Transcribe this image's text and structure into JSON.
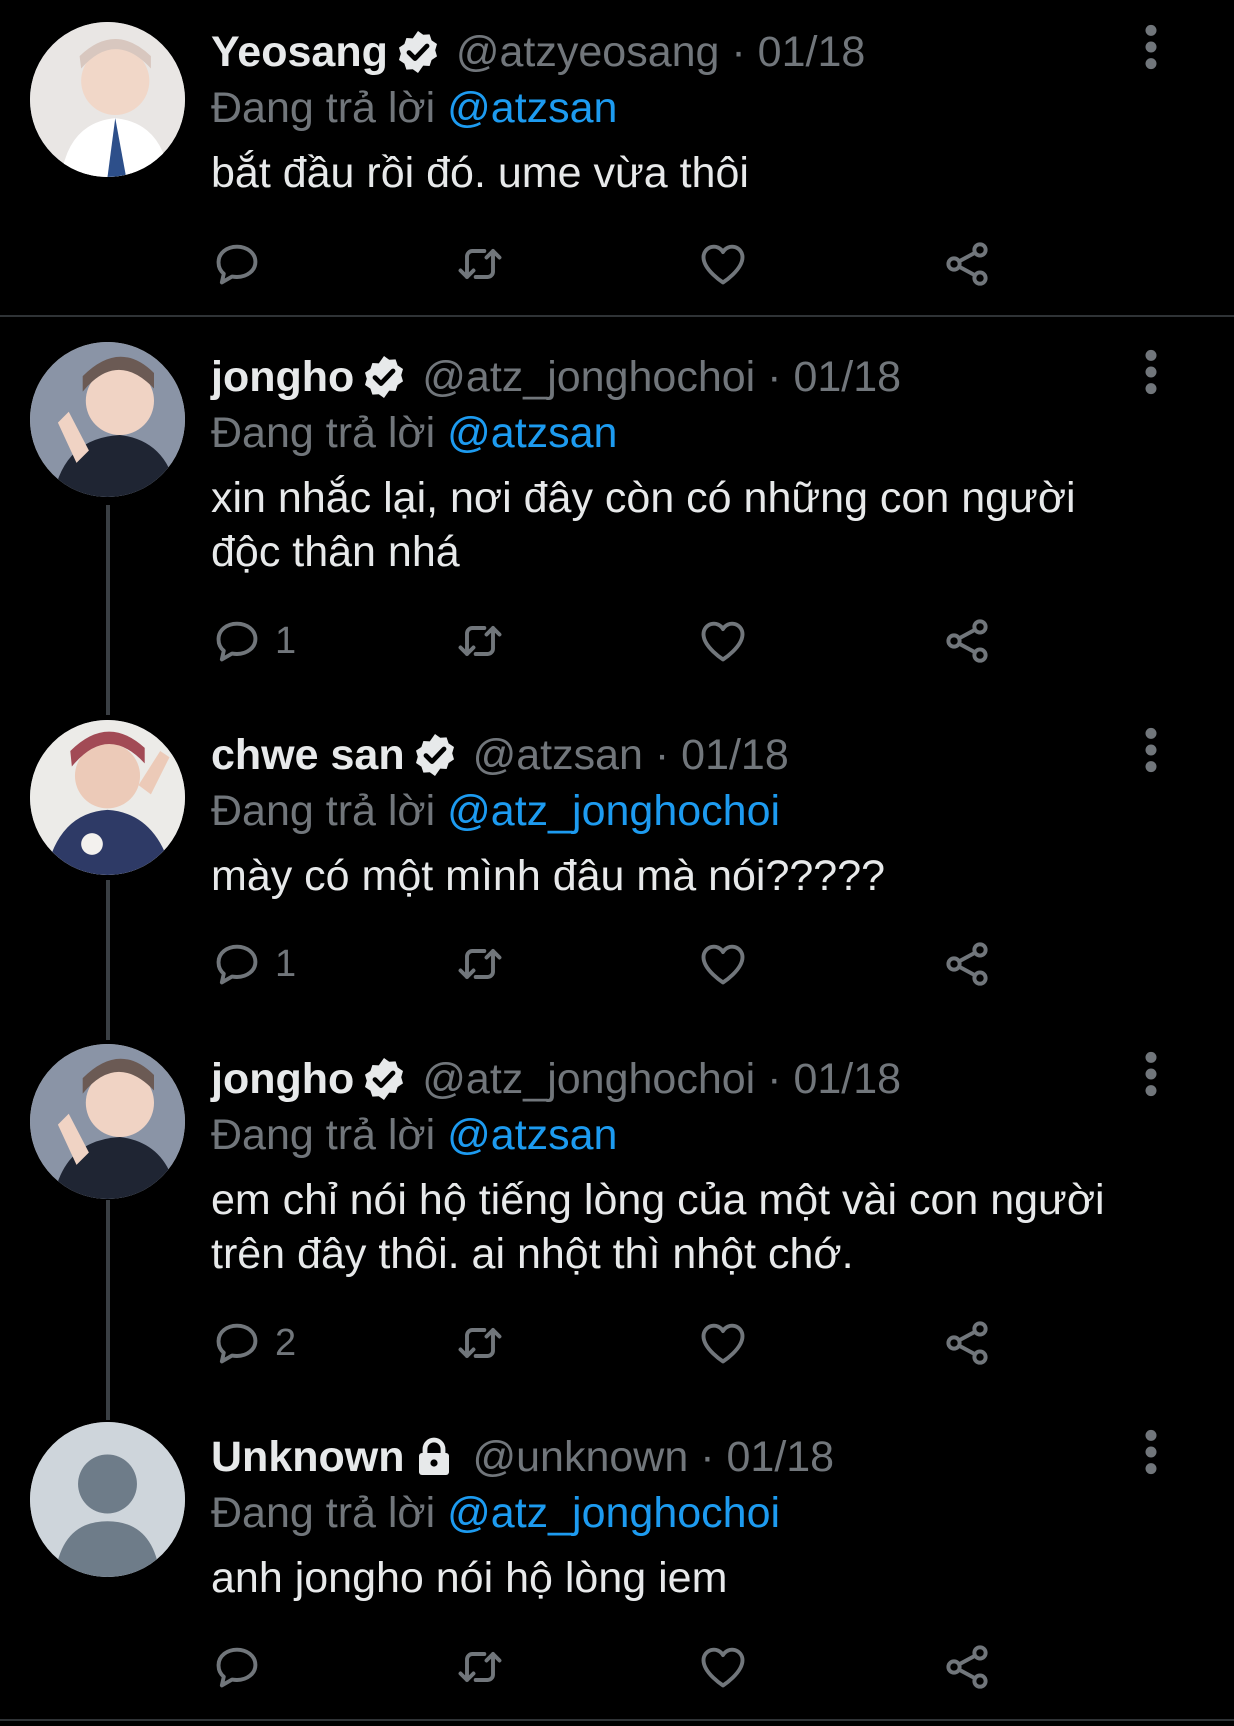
{
  "tweets": [
    {
      "name": "Yeosang",
      "verified": true,
      "locked": false,
      "handle": "@atzyeosang",
      "date": "01/18",
      "replying_prefix": "Đang trả lời ",
      "replying_to": "@atzsan",
      "text": "bắt đầu rồi đó. ume vừa thôi",
      "reply_count": "",
      "avatar": "photo-avatar"
    },
    {
      "name": "jongho",
      "verified": true,
      "locked": false,
      "handle": "@atz_jonghochoi",
      "date": "01/18",
      "replying_prefix": "Đang trả lời ",
      "replying_to": "@atzsan",
      "text": "xin nhắc lại, nơi đây còn có những con người độc thân nhá",
      "reply_count": "1",
      "avatar": "photo-avatar"
    },
    {
      "name": "chwe san",
      "verified": true,
      "locked": false,
      "handle": "@atzsan",
      "date": "01/18",
      "replying_prefix": "Đang trả lời ",
      "replying_to": "@atz_jonghochoi",
      "text": "mày có một mình đâu mà nói?????",
      "reply_count": "1",
      "avatar": "photo-avatar"
    },
    {
      "name": "jongho",
      "verified": true,
      "locked": false,
      "handle": "@atz_jonghochoi",
      "date": "01/18",
      "replying_prefix": "Đang trả lời ",
      "replying_to": "@atzsan",
      "text": "em chỉ nói hộ tiếng lòng của một vài con người trên đây thôi. ai nhột thì nhột chớ.",
      "reply_count": "2",
      "avatar": "photo-avatar"
    },
    {
      "name": "Unknown",
      "verified": false,
      "locked": true,
      "handle": "@unknown",
      "date": "01/18",
      "replying_prefix": "Đang trả lời ",
      "replying_to": "@atz_jonghochoi",
      "text": "anh jongho nói hộ lòng iem",
      "reply_count": "",
      "avatar": "default-avatar"
    }
  ],
  "colors": {
    "background": "#000000",
    "text": "#e7e9ea",
    "muted": "#71767b",
    "mention": "#1d9bf0",
    "divider": "#2f3336"
  },
  "icons": [
    "reply-icon",
    "retweet-icon",
    "like-icon",
    "share-icon",
    "more-icon",
    "verified-badge-icon",
    "lock-icon"
  ]
}
